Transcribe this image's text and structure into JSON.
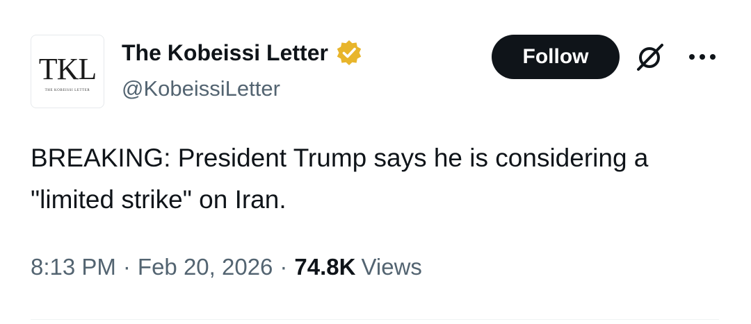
{
  "author": {
    "display_name": "The Kobeissi Letter",
    "handle": "@KobeissiLetter",
    "avatar_mark": "TKL",
    "avatar_subtitle": "THE KOBEISSI LETTER",
    "verified_badge_icon": "verified-gold-badge-icon",
    "verified_color": "#e8b52b"
  },
  "actions": {
    "follow_label": "Follow",
    "grok_icon": "grok-icon",
    "more_icon": "more-options-icon"
  },
  "tweet": {
    "text": "BREAKING: President Trump says he is considering a \"limited strike\" on Iran."
  },
  "meta": {
    "time": "8:13 PM",
    "separator": "·",
    "date": "Feb 20, 2026",
    "views_count": "74.8K",
    "views_label": "Views"
  },
  "colors": {
    "text_primary": "#0f1419",
    "text_secondary": "#536471",
    "button_bg": "#0f1419",
    "button_text": "#ffffff"
  }
}
